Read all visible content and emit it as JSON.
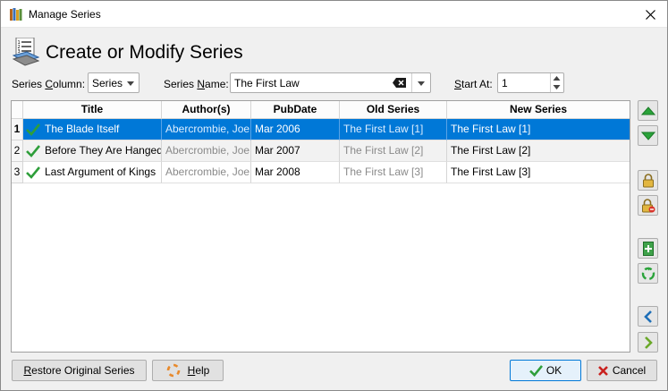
{
  "window": {
    "title": "Manage Series"
  },
  "header": {
    "title": "Create or Modify Series"
  },
  "controls": {
    "series_column_label_pre": "Series ",
    "series_column_label_key": "C",
    "series_column_label_post": "olumn:",
    "series_column_value": "Series",
    "series_name_label_pre": "Series ",
    "series_name_label_key": "N",
    "series_name_label_post": "ame:",
    "series_name_value": "The First Law",
    "start_at_label_key": "S",
    "start_at_label_post": "tart At:",
    "start_at_value": "1"
  },
  "table": {
    "columns": [
      "Title",
      "Author(s)",
      "PubDate",
      "Old Series",
      "New Series"
    ],
    "rows": [
      {
        "num": "1",
        "title": "The Blade Itself",
        "author": "Abercrombie, Joe",
        "pubdate": "Mar 2006",
        "old_series": "The First Law [1]",
        "new_series": "The First Law [1]"
      },
      {
        "num": "2",
        "title": "Before They Are Hanged",
        "author": "Abercrombie, Joe",
        "pubdate": "Mar 2007",
        "old_series": "The First Law [2]",
        "new_series": "The First Law [2]"
      },
      {
        "num": "3",
        "title": "Last Argument of Kings",
        "author": "Abercrombie, Joe",
        "pubdate": "Mar 2008",
        "old_series": "The First Law [3]",
        "new_series": "The First Law [3]"
      }
    ]
  },
  "buttons": {
    "restore_pre": "",
    "restore_key": "R",
    "restore_post": "estore Original Series",
    "help_key": "H",
    "help_post": "elp",
    "ok": "OK",
    "cancel": "Cancel"
  },
  "colors": {
    "selection": "#0078d7",
    "check": "#2e9e3a",
    "arrow_green": "#2aa33a",
    "arrow_blue": "#1e6fb8"
  }
}
